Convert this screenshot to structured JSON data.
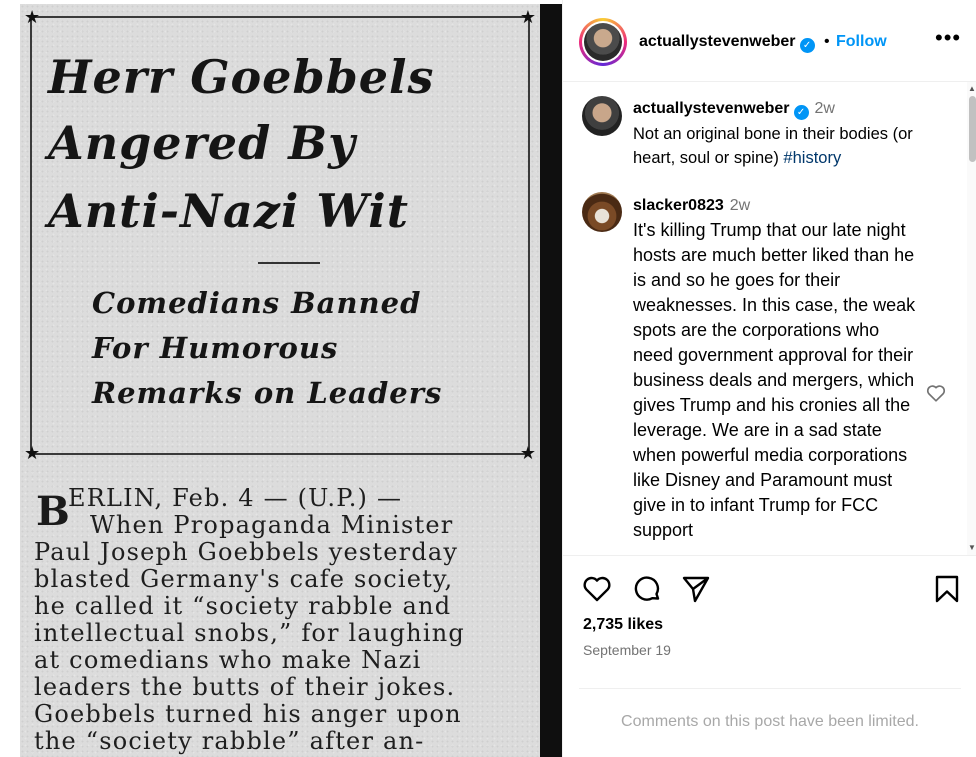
{
  "header": {
    "username": "actuallystevenweber",
    "verified": true,
    "separator": "•",
    "follow_label": "Follow",
    "more_label": "•••"
  },
  "comments": [
    {
      "username": "actuallystevenweber",
      "verified": true,
      "time": "2w",
      "text_before_tag": "Not an original bone in their bodies (or heart, soul or spine) ",
      "hashtag": "#history"
    },
    {
      "username": "slacker0823",
      "verified": false,
      "time": "2w",
      "text": "It's killing Trump that our late night hosts are much better liked than he is and so he goes for their weaknesses. In this case, the weak spots are the corporations who need government approval for their business deals and mergers, which gives Trump and his cronies all the leverage. We are in a sad state when powerful media corporations like Disney and Paramount must give in to infant Trump for FCC support"
    }
  ],
  "post": {
    "likes": "2,735 likes",
    "date": "September 19",
    "comments_limited": "Comments on this post have been limited."
  },
  "clipping": {
    "headline": [
      "Herr Goebbels",
      "Angered By",
      "Anti-Nazi Wit"
    ],
    "subhead": [
      "Comedians Banned",
      "For Humorous",
      "Remarks on Leaders"
    ],
    "dropcap": "B",
    "body": [
      "ERLIN,  Feb. 4 — (U.P.) —",
      "When  Propaganda  Minister",
      "Paul Joseph Goebbels yesterday",
      "blasted  Germany's  cafe society,",
      "he called it “society rabble and",
      "intellectual snobs,” for laughing",
      "at comedians who make Nazi",
      "leaders the butts of their jokes.",
      "  Goebbels turned his anger upon",
      "the “society rabble” after an-"
    ]
  },
  "colors": {
    "link_blue": "#0095f6",
    "hashtag": "#00376b",
    "muted": "#737373",
    "limited_text": "#a8a8a8",
    "verified": "#0095f6"
  },
  "icons": {
    "like": "heart-icon",
    "comment": "comment-icon",
    "share": "share-icon",
    "save": "bookmark-icon",
    "comment_like": "heart-icon"
  }
}
